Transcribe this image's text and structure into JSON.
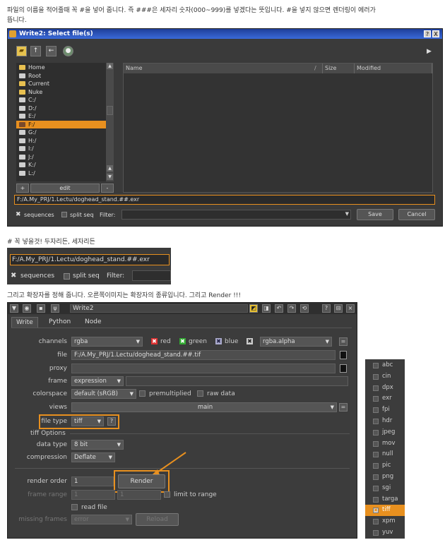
{
  "captions": {
    "intro": "파일의 이름을 적어줄때 꼭 #을 넣어 줍니다. 즉 ###은 세자리 숫자(000~999)를 넣겠다는 뜻입니다. #을 넣지 않으면 렌더링이 에러가",
    "intro2": "뜹니다.",
    "snippet": "# 꼭 넣을것! 두자리든, 세자리든",
    "render": "그리고 확장자를 정해 줍니다. 오른쪽이미지는 확장자의 종류입니다. 그리고 Render !!!"
  },
  "dialog": {
    "title": "Write2: Select file(s)",
    "help_btn": "?",
    "close_btn": "X",
    "places": [
      "Home",
      "Root",
      "Current",
      "Nuke",
      "C:/",
      "D:/",
      "E:/",
      "F:/",
      "G:/",
      "H:/",
      "I:/",
      "J:/",
      "K:/",
      "L:/"
    ],
    "selected_place": "F:/",
    "add_btn": "+",
    "edit_btn": "edit",
    "remove_btn": "-",
    "columns": [
      "Name",
      "Size",
      "Modified"
    ],
    "path": "F:/A.My_PRJ/1.Lectu/doghead_stand.##.exr",
    "sequences_label": "sequences",
    "splitseq_label": "split seq",
    "filter_label": "Filter:",
    "save_btn": "Save",
    "cancel_btn": "Cancel"
  },
  "snippet": {
    "path": "F:/A.My_PRJ/1.Lectu/doghead_stand.##.exr",
    "sequences_label": "sequences",
    "splitseq_label": "split seq",
    "filter_label": "Filter:"
  },
  "panel": {
    "node_name": "Write2",
    "tabs": [
      "Write",
      "Python",
      "Node"
    ],
    "channels_label": "channels",
    "channels_value": "rgba",
    "ch_red": "red",
    "ch_green": "green",
    "ch_blue": "blue",
    "alpha_value": "rgba.alpha",
    "file_label": "file",
    "file_value": "F:/A.My_PRJ/1.Lectu/doghead_stand.##.tif",
    "proxy_label": "proxy",
    "frame_label": "frame",
    "frame_value": "expression",
    "colorspace_label": "colorspace",
    "colorspace_value": "default (sRGB)",
    "premultiplied_label": "premultiplied",
    "rawdata_label": "raw data",
    "views_label": "views",
    "views_value": "main",
    "filetype_label": "file type",
    "filetype_value": "tiff",
    "filetype_help": "?",
    "tiff_options": "tiff Options",
    "datatype_label": "data type",
    "datatype_value": "8 bit",
    "compression_label": "compression",
    "compression_value": "Deflate",
    "renderorder_label": "render order",
    "renderorder_value": "1",
    "render_btn": "Render",
    "framerange_label": "frame range",
    "framerange_start": "1",
    "framerange_end": "1",
    "limit_label": "limit to range",
    "readfile_label": "read file",
    "missing_label": "missing frames",
    "missing_value": "error",
    "reload_btn": "Reload"
  },
  "formats": {
    "items": [
      "abc",
      "cin",
      "dpx",
      "exr",
      "fpi",
      "hdr",
      "jpeg",
      "mov",
      "null",
      "pic",
      "png",
      "sgi",
      "targa",
      "tiff",
      "xpm",
      "yuv"
    ],
    "selected": "tiff"
  },
  "colors": {
    "accent": "#e8901f",
    "panel_bg": "#3c3c3c"
  }
}
